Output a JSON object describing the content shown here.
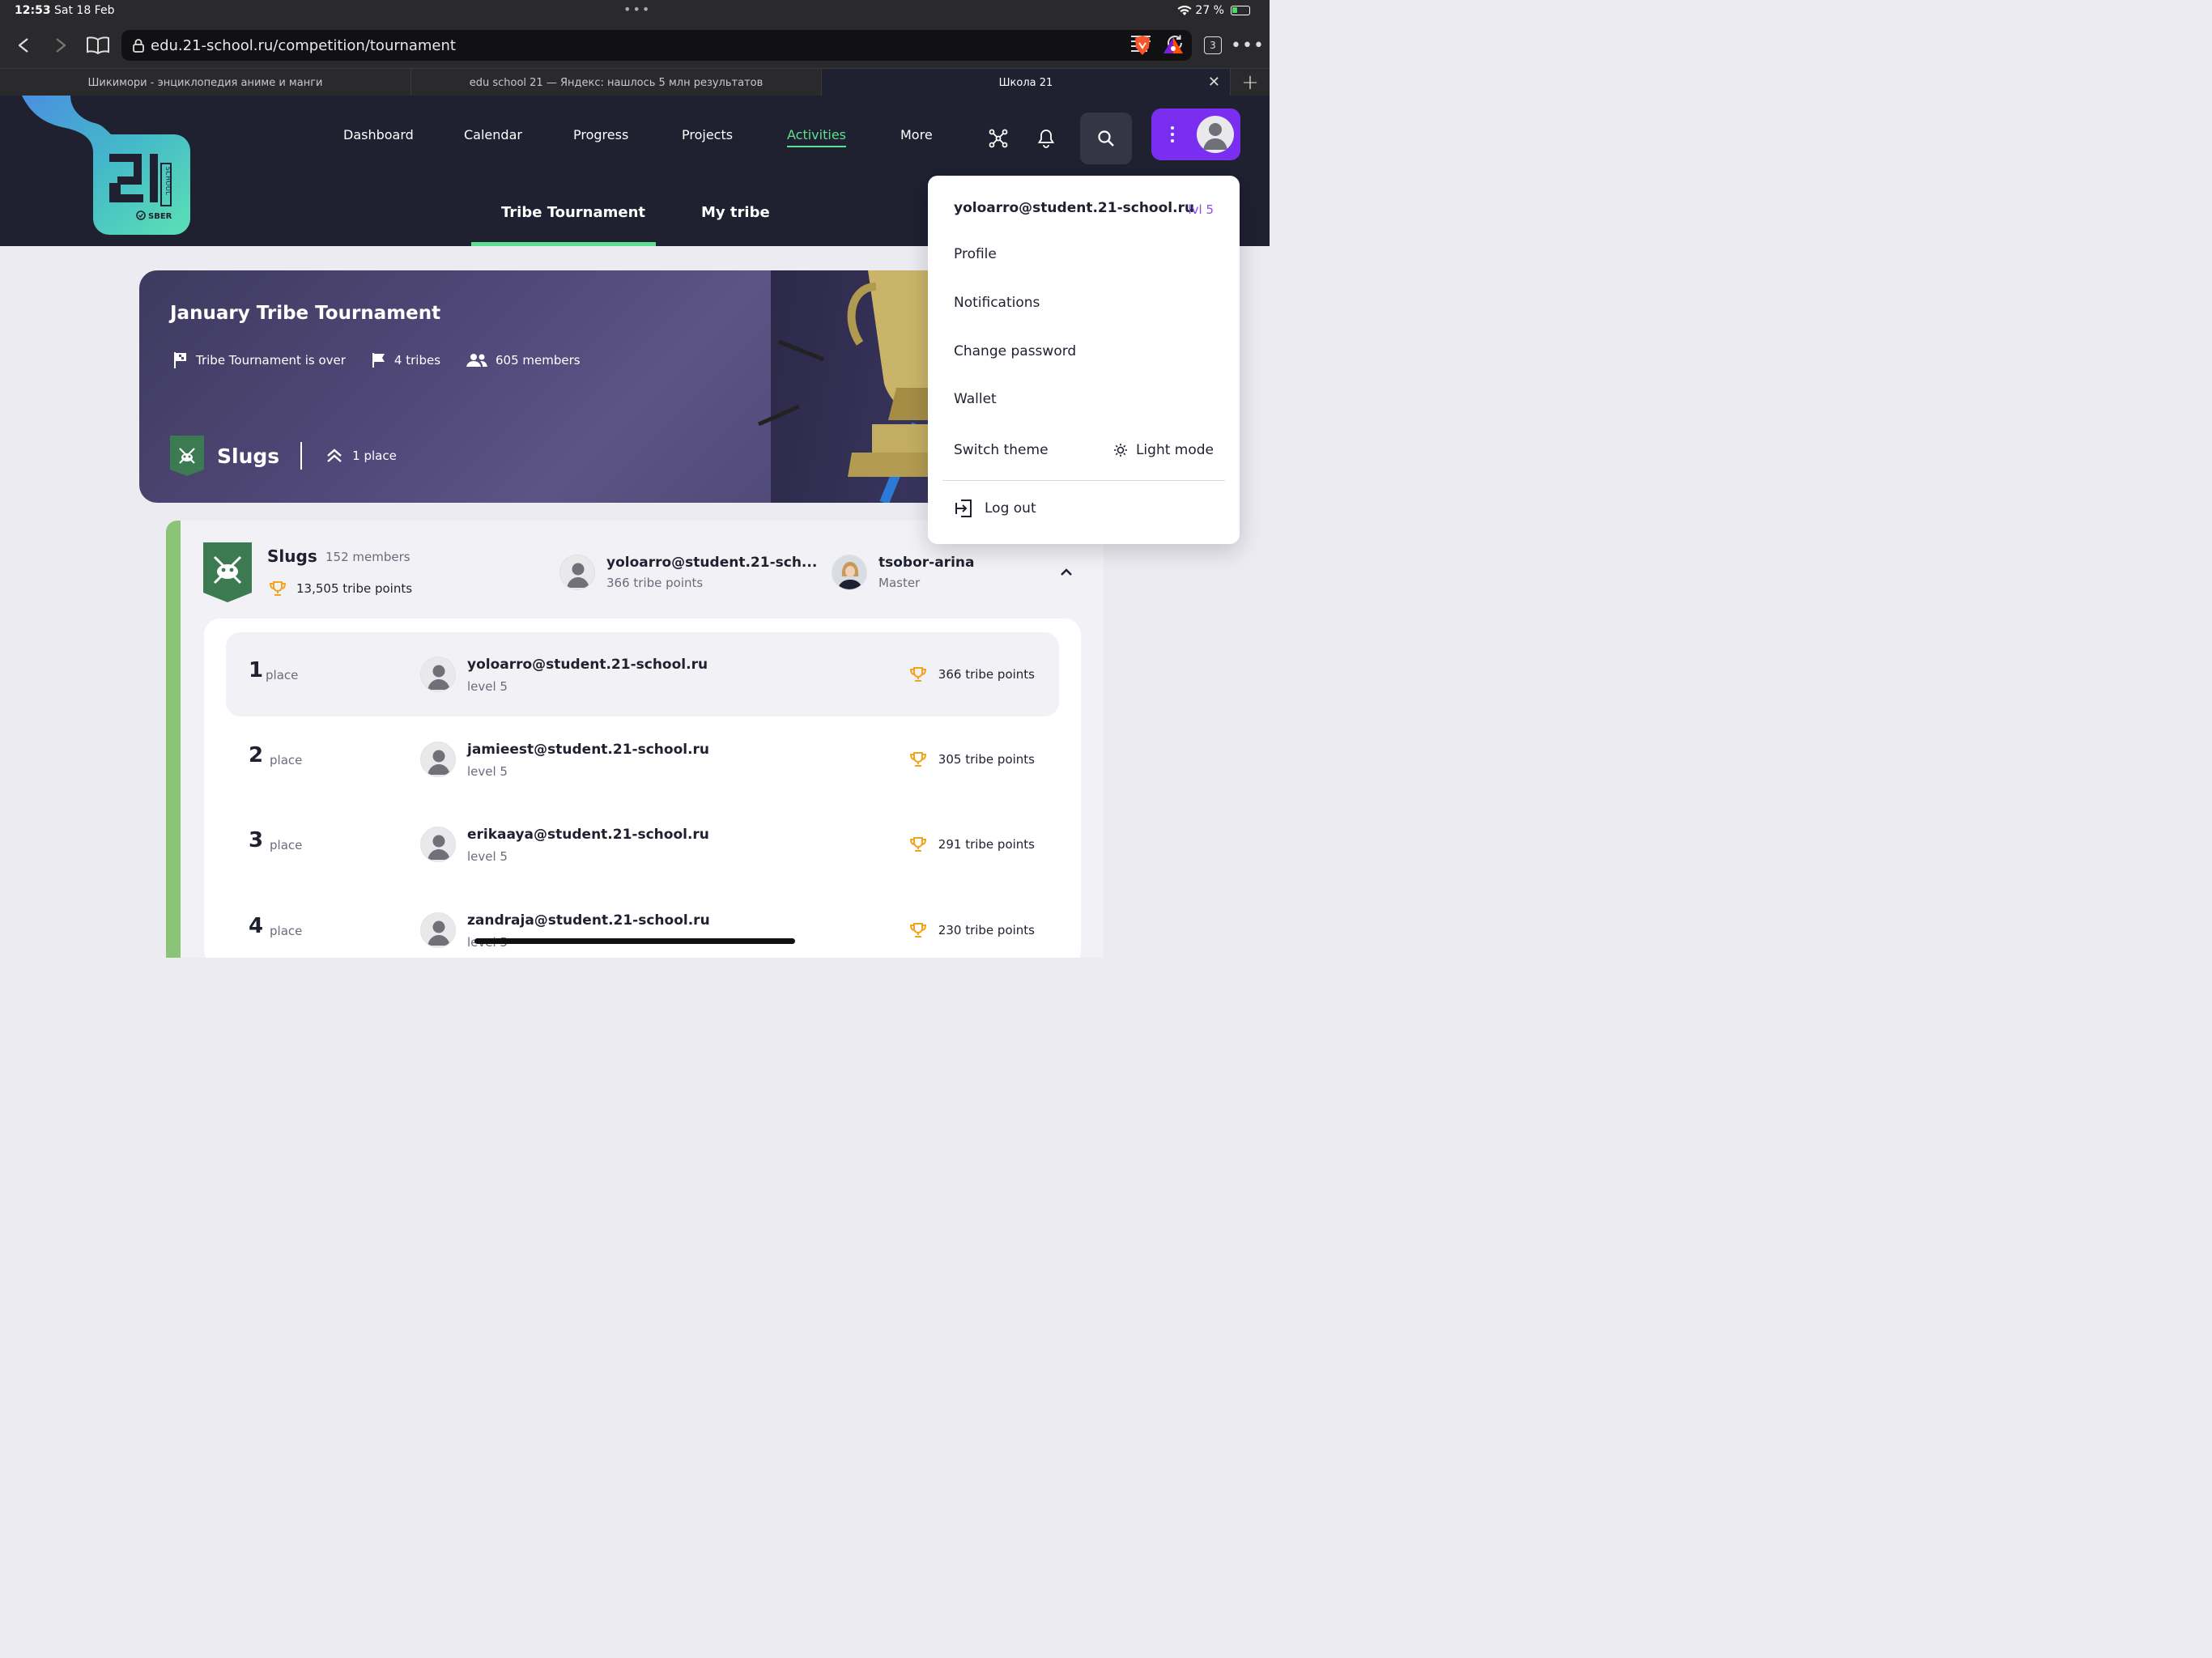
{
  "status": {
    "time": "12:53",
    "date": "Sat 18 Feb",
    "battery": "27 %"
  },
  "browser": {
    "url": "edu.21-school.ru/competition/tournament",
    "tab_count": "3",
    "tabs": [
      {
        "title": "Шикимори - энциклопедия аниме и манги",
        "active": false
      },
      {
        "title": "edu school 21 — Яндекс: нашлось 5 млн результатов",
        "active": false
      },
      {
        "title": "Школа 21",
        "active": true
      }
    ]
  },
  "logo": {
    "number": "21",
    "school": "SCHOOL",
    "brand": "SBER"
  },
  "nav": {
    "items": [
      "Dashboard",
      "Calendar",
      "Progress",
      "Projects",
      "Activities",
      "More"
    ],
    "active": "Activities"
  },
  "subtabs": [
    "Tribe Tournament",
    "My tribe"
  ],
  "banner": {
    "title": "January Tribe Tournament",
    "status": "Tribe Tournament is over",
    "tribes": "4 tribes",
    "members": "605 members",
    "tribe_name": "Slugs",
    "tribe_place": "1 place"
  },
  "tribe": {
    "name": "Slugs",
    "members": "152 members",
    "points": "13,505 tribe points",
    "top_user": {
      "login": "yoloarro@student.21-sch...",
      "points": "366 tribe points"
    },
    "master": {
      "login": "tsobor-arina",
      "role": "Master"
    }
  },
  "ranking": [
    {
      "place": "1",
      "place_label": "place",
      "login": "yoloarro@student.21-school.ru",
      "level": "level 5",
      "points": "366 tribe points"
    },
    {
      "place": "2",
      "place_label": "place",
      "login": "jamieest@student.21-school.ru",
      "level": "level 5",
      "points": "305 tribe points"
    },
    {
      "place": "3",
      "place_label": "place",
      "login": "erikaaya@student.21-school.ru",
      "level": "level 5",
      "points": "291 tribe points"
    },
    {
      "place": "4",
      "place_label": "place",
      "login": "zandraja@student.21-school.ru",
      "level": "level 5",
      "points": "230 tribe points"
    }
  ],
  "menu": {
    "user": "yoloarro@student.21-school.ru",
    "level": "lvl 5",
    "items": [
      "Profile",
      "Notifications",
      "Change password",
      "Wallet"
    ],
    "switch_theme": "Switch theme",
    "theme_value": "Light mode",
    "logout": "Log out"
  },
  "colors": {
    "accent": "#5ce08f",
    "profile": "#7a2ef0",
    "header": "#1f2030",
    "tribe": "#3c7a52",
    "trophy": "#f2a41c",
    "level": "#8d48f5"
  }
}
